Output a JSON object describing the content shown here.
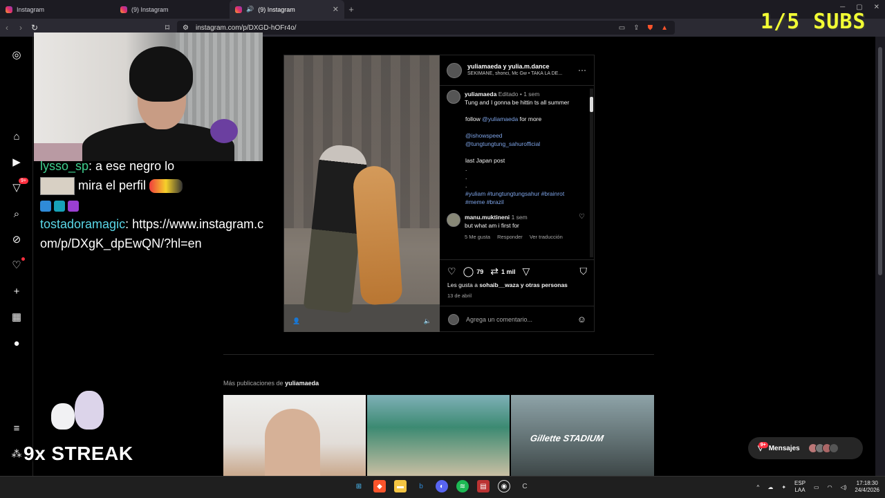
{
  "browser": {
    "tabs": [
      {
        "label": "Instagram",
        "active": false
      },
      {
        "label": "(9) Instagram",
        "active": false
      },
      {
        "label": "(9) Instagram",
        "active": true
      }
    ],
    "url": "instagram.com/p/DXGD-hOFr4o/"
  },
  "overlay": {
    "subs": "1/5 SUBS",
    "streak": "9x STREAK",
    "chat": {
      "line1_user": "lysso_sp",
      "line1_text": ": a ese negro lo",
      "line2_text": "mira el perfil",
      "line3_user": "tostadoramagic",
      "line3_text": ": https://www.instagram.com/p/DXgK_dpEwQN/?hl=en"
    }
  },
  "rail": {
    "notif_badge": "9+"
  },
  "post": {
    "header_title": "yuliamaeda y yulia.m.dance",
    "header_sub": "SEKIMANE, shonci, Mc Gw • TAKA LA DE...",
    "caption_user": "yuliamaeda",
    "caption_meta": "Editado • 1 sem",
    "caption_l1": "Tung and I gonna be hittin ts all summer",
    "caption_l2": "follow",
    "caption_mention": "@yuliamaeda",
    "caption_l2b": "for more",
    "mention1": "@ishowspeed",
    "mention2": "@tungtungtung_sahurofficial",
    "caption_l3": "last Japan post",
    "hashtags": "#yuliam #tungtungtungsahur #brainrot #meme #brazil",
    "comment_user": "manu.muktineni",
    "comment_time": "1 sem",
    "comment_text": "but what am i first for",
    "comment_likes": "5 Me gusta",
    "comment_reply": "Responder",
    "comment_translate": "Ver traducción",
    "comments_count": "79",
    "shares_count": "1 mil",
    "likes_text": "Les gusta a",
    "likes_user": "sohaib__waza",
    "likes_rest": "y otras personas",
    "date": "13 de abril",
    "add_comment_placeholder": "Agrega un comentario..."
  },
  "more_posts": {
    "label": "Más publicaciones de",
    "user": "yuliamaeda",
    "thumb3_text": "Gillette STADIUM"
  },
  "messages": {
    "label": "Mensajes",
    "badge": "9+"
  },
  "taskbar": {
    "lang1": "ESP",
    "lang2": "LAA",
    "time": "17:18:30",
    "date": "24/4/2026"
  }
}
